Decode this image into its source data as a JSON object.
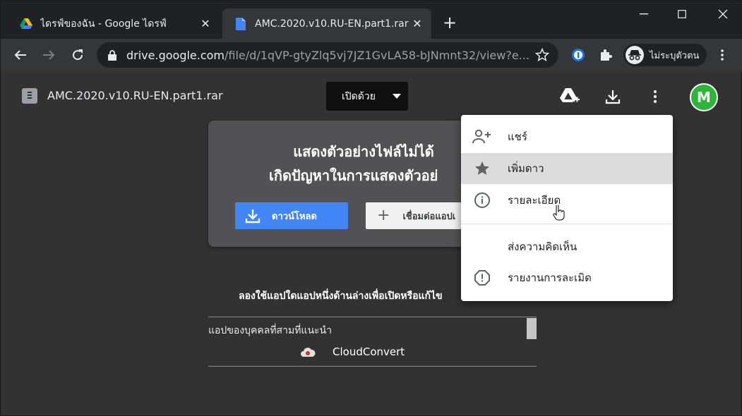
{
  "browser": {
    "tabs": [
      {
        "title": "ไดรฟ์ของฉัน - Google ไดรฟ์",
        "icon": "google-drive-icon",
        "active": false
      },
      {
        "title": "AMC.2020.v10.RU-EN.part1.rar - Google",
        "icon": "document-icon",
        "active": true
      }
    ],
    "url_host": "drive.google.com",
    "url_path": "/file/d/1qVP-gtyZlq5vj7JZ1GvLA58-bJNmnt32/view?e...",
    "profile_label": "ไม่ระบุตัวตน"
  },
  "viewer": {
    "file_title": "AMC.2020.v10.RU-EN.part1.rar",
    "open_with_label": "เปิดด้วย",
    "avatar_letter": "M"
  },
  "preview": {
    "heading": "แสดงตัวอย่างไฟล์ไม่ได้",
    "subheading": "เกิดปัญหาในการแสดงตัวอย่",
    "download_label": "ดาวน์โหลด",
    "connect_label": "เชื่อมต่อแอปเ"
  },
  "apps": {
    "try_text": "ลองใช้แอปใดแอปหนึ่งด้านล่างเพื่อเปิดหรือแก้ไข",
    "header": "แอปของบุคคลที่สามที่แนะนำ",
    "items": [
      {
        "name": "CloudConvert"
      }
    ]
  },
  "menu": {
    "items": [
      {
        "label": "แชร์",
        "icon": "add-person-icon"
      },
      {
        "label": "เพิ่มดาว",
        "icon": "star-icon",
        "hovered": true
      },
      {
        "label": "รายละเอียด",
        "icon": "info-icon"
      },
      {
        "label": "ส่งความคิดเห็น",
        "icon": ""
      },
      {
        "label": "รายงานการละเมิด",
        "icon": "report-icon"
      }
    ]
  },
  "colors": {
    "drive_blue": "#4285f4",
    "avatar_green": "#2db53a",
    "page_bg": "#323232"
  }
}
